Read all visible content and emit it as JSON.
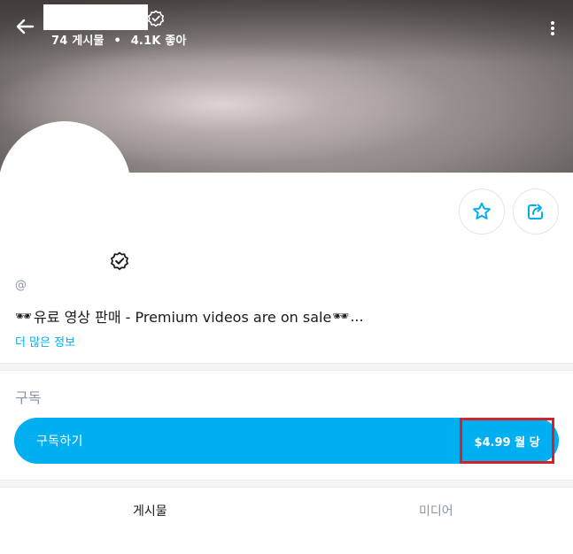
{
  "header": {
    "stats": {
      "posts": "74 게시물",
      "separator": "•",
      "likes": "4.1K 좋아"
    }
  },
  "profile": {
    "handle_prefix": "@",
    "bio_text": "유료 영상 판매 - Premium videos are on sale",
    "bio_emoji": "🕶",
    "bio_ellipsis": "...",
    "more_info_label": "더 많은 정보"
  },
  "subscription": {
    "section_title": "구독",
    "button_label": "구독하기",
    "price": "$4.99 월 당"
  },
  "tabs": [
    {
      "label": "게시물"
    },
    {
      "label": "미디어"
    }
  ],
  "icons": {
    "back": "arrow-left-icon",
    "verified": "verified-badge-icon",
    "more": "more-vertical-icon",
    "favorite": "star-icon",
    "share": "share-icon"
  },
  "colors": {
    "accent": "#00aff0",
    "highlight_box": "#d2232a",
    "muted_text": "#8a96a3"
  }
}
